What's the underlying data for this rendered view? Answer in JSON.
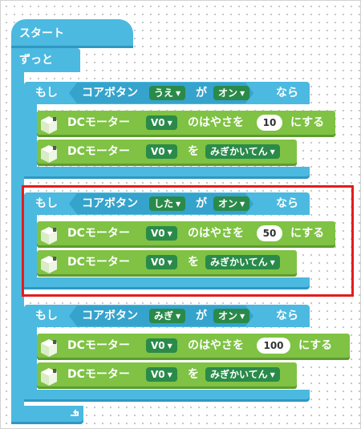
{
  "start_label": "スタート",
  "forever_label": "ずっと",
  "if_blocks": [
    {
      "if_label": "もし",
      "button_label": "コアボタン",
      "button_option": "うえ",
      "ga_label": "が",
      "state_option": "オン",
      "then_label": "なら",
      "speed_block": {
        "label": "DCモーター",
        "port": "V0",
        "text": "のはやさを",
        "value": "10",
        "suffix": "にする"
      },
      "dir_block": {
        "label": "DCモーター",
        "port": "V0",
        "text": "を",
        "direction": "みぎかいてん"
      }
    },
    {
      "if_label": "もし",
      "button_label": "コアボタン",
      "button_option": "した",
      "ga_label": "が",
      "state_option": "オン",
      "then_label": "なら",
      "speed_block": {
        "label": "DCモーター",
        "port": "V0",
        "text": "のはやさを",
        "value": "50",
        "suffix": "にする"
      },
      "dir_block": {
        "label": "DCモーター",
        "port": "V0",
        "text": "を",
        "direction": "みぎかいてん"
      }
    },
    {
      "if_label": "もし",
      "button_label": "コアボタン",
      "button_option": "みぎ",
      "ga_label": "が",
      "state_option": "オン",
      "then_label": "なら",
      "speed_block": {
        "label": "DCモーター",
        "port": "V0",
        "text": "のはやさを",
        "value": "100",
        "suffix": "にする"
      },
      "dir_block": {
        "label": "DCモーター",
        "port": "V0",
        "text": "を",
        "direction": "みぎかいてん"
      }
    }
  ],
  "loop_end_icon": "loop-arrow-icon",
  "motor_icon": "motor-cube-icon",
  "dropdown_arrow_icon": "dropdown-arrow-icon",
  "highlight_color": "#e31c1c",
  "cyan_color": "#4cb9e0",
  "green_color": "#7fc244"
}
